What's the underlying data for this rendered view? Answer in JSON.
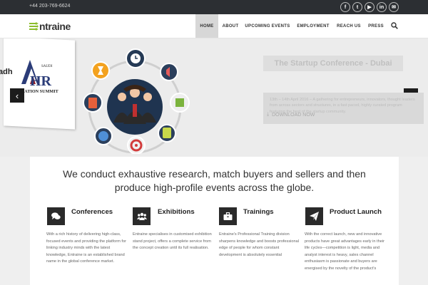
{
  "topbar": {
    "phone": "+44 203-769-6624",
    "social": [
      {
        "icon": "facebook-icon",
        "glyph": "f"
      },
      {
        "icon": "twitter-icon",
        "glyph": "t"
      },
      {
        "icon": "youtube-icon",
        "glyph": "▶"
      },
      {
        "icon": "linkedin-icon",
        "glyph": "in"
      },
      {
        "icon": "email-icon",
        "glyph": "✉"
      }
    ]
  },
  "header": {
    "logo_text": "ntraine",
    "nav": [
      {
        "label": "HOME",
        "active": true
      },
      {
        "label": "ABOUT",
        "active": false
      },
      {
        "label": "UPCOMING EVENTS",
        "active": false
      },
      {
        "label": "EMPLOYMENT",
        "active": false
      },
      {
        "label": "REACH US",
        "active": false
      },
      {
        "label": "PRESS",
        "active": false
      }
    ]
  },
  "hero": {
    "partial_city": "adh",
    "hr_logo": {
      "saudi": "SAUDI",
      "hr": "HR",
      "summit": "RMATION SUMMIT"
    },
    "slide_title": "The Startup Conference - Dubai",
    "slide_text": "13th – 14th April 2016 – A gathering for entrepreneurs, innovators, thought leaders from across sectors and structures, in a fast paced, highly curated program featuring the best of the startup community.",
    "download_label": "DOWNLOAD NOW",
    "prev_arrow": "‹",
    "next_arrow": "›"
  },
  "intro": {
    "headline": "We conduct exhaustive research, match buyers and sellers and then produce high-profile events across the globe.",
    "features": [
      {
        "icon": "chat-bubbles-icon",
        "title": "Conferences",
        "text": "With a rich history of delivering high-class, focused events and providing the platform for linking industry minds with the latest knowledge, Entraine is an established brand name in the global conference market."
      },
      {
        "icon": "group-icon",
        "title": "Exhibitions",
        "text": "Entraine specialises in customised exhibition stand project, offers a complete service from the concept creation until its full realisation."
      },
      {
        "icon": "briefcase-icon",
        "title": "Trainings",
        "text": "Entraine's Professional Training division sharpens knowledge and boosts professional edge of people for whom constant development is absolutely essential"
      },
      {
        "icon": "paper-plane-icon",
        "title": "Product Launch",
        "text": "With the correct launch, new and innovative products have great advantages early in their life cycles—competition is light, media and analyst interest is heavy, sales channel enthusiasm is passionate and buyers are energised by the novelty of the product's"
      }
    ]
  },
  "colors": {
    "accent_green": "#8bbd2b",
    "dark": "#2c2f33",
    "nav_active": "#d7d7d7"
  }
}
